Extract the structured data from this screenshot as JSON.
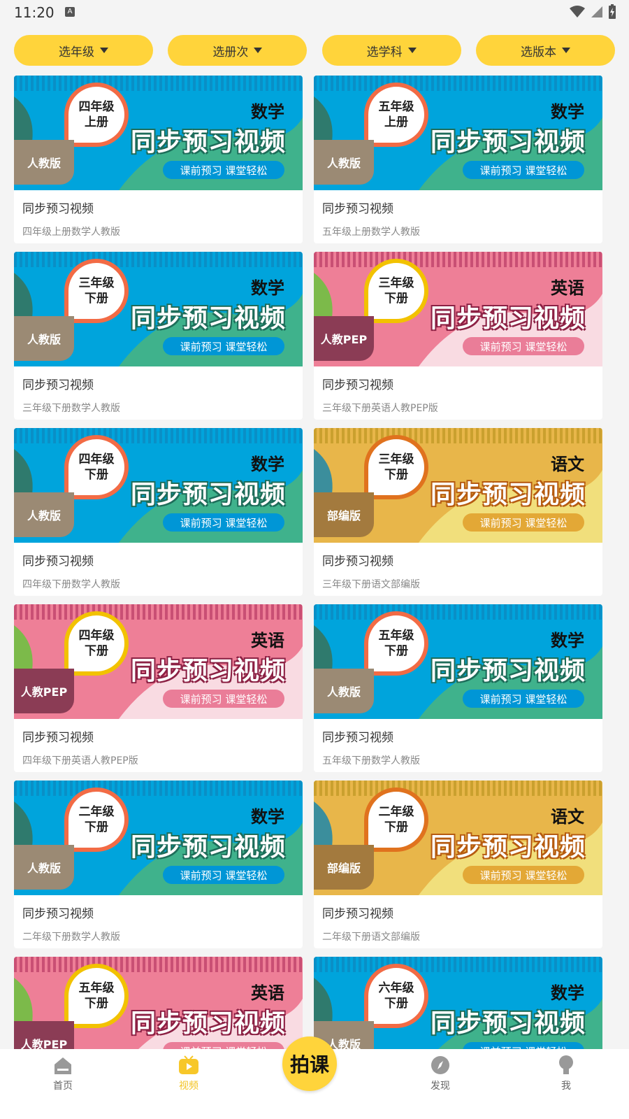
{
  "status": {
    "time": "11:20",
    "a_badge": "A"
  },
  "filters": [
    {
      "label": "选年级"
    },
    {
      "label": "选册次"
    },
    {
      "label": "选学科"
    },
    {
      "label": "选版本"
    }
  ],
  "cards": [
    {
      "grade": "四年级",
      "term": "上册",
      "edition": "人教版",
      "subject": "数学",
      "theme": "math",
      "headline": "同步预习视频",
      "pill": "课前预习 课堂轻松",
      "title": "同步预习视频",
      "subtitle": "四年级上册数学人教版"
    },
    {
      "grade": "五年级",
      "term": "上册",
      "edition": "人教版",
      "subject": "数学",
      "theme": "math",
      "headline": "同步预习视频",
      "pill": "课前预习 课堂轻松",
      "title": "同步预习视频",
      "subtitle": "五年级上册数学人教版"
    },
    {
      "grade": "三年级",
      "term": "下册",
      "edition": "人教版",
      "subject": "数学",
      "theme": "math",
      "headline": "同步预习视频",
      "pill": "课前预习 课堂轻松",
      "title": "同步预习视频",
      "subtitle": "三年级下册数学人教版"
    },
    {
      "grade": "三年级",
      "term": "下册",
      "edition": "人教PEP",
      "subject": "英语",
      "theme": "eng",
      "headline": "同步预习视频",
      "pill": "课前预习 课堂轻松",
      "title": "同步预习视频",
      "subtitle": "三年级下册英语人教PEP版"
    },
    {
      "grade": "四年级",
      "term": "下册",
      "edition": "人教版",
      "subject": "数学",
      "theme": "math",
      "headline": "同步预习视频",
      "pill": "课前预习 课堂轻松",
      "title": "同步预习视频",
      "subtitle": "四年级下册数学人教版"
    },
    {
      "grade": "三年级",
      "term": "下册",
      "edition": "部编版",
      "subject": "语文",
      "theme": "chn",
      "headline": "同步预习视频",
      "pill": "课前预习 课堂轻松",
      "title": "同步预习视频",
      "subtitle": "三年级下册语文部编版"
    },
    {
      "grade": "四年级",
      "term": "下册",
      "edition": "人教PEP",
      "subject": "英语",
      "theme": "eng",
      "headline": "同步预习视频",
      "pill": "课前预习 课堂轻松",
      "title": "同步预习视频",
      "subtitle": "四年级下册英语人教PEP版"
    },
    {
      "grade": "五年级",
      "term": "下册",
      "edition": "人教版",
      "subject": "数学",
      "theme": "math",
      "headline": "同步预习视频",
      "pill": "课前预习 课堂轻松",
      "title": "同步预习视频",
      "subtitle": "五年级下册数学人教版"
    },
    {
      "grade": "二年级",
      "term": "下册",
      "edition": "人教版",
      "subject": "数学",
      "theme": "math",
      "headline": "同步预习视频",
      "pill": "课前预习 课堂轻松",
      "title": "同步预习视频",
      "subtitle": "二年级下册数学人教版"
    },
    {
      "grade": "二年级",
      "term": "下册",
      "edition": "部编版",
      "subject": "语文",
      "theme": "chn",
      "headline": "同步预习视频",
      "pill": "课前预习 课堂轻松",
      "title": "同步预习视频",
      "subtitle": "二年级下册语文部编版"
    },
    {
      "grade": "五年级",
      "term": "下册",
      "edition": "人教PEP",
      "subject": "英语",
      "theme": "eng",
      "headline": "同步预习视频",
      "pill": "课前预习 课堂轻松",
      "title": "",
      "subtitle": ""
    },
    {
      "grade": "六年级",
      "term": "下册",
      "edition": "人教版",
      "subject": "数学",
      "theme": "math",
      "headline": "同步预习视频",
      "pill": "课前预习 课堂轻松",
      "title": "",
      "subtitle": ""
    }
  ],
  "nav": {
    "home": "首页",
    "video": "视频",
    "center": "拍课",
    "discover": "发现",
    "me": "我"
  }
}
